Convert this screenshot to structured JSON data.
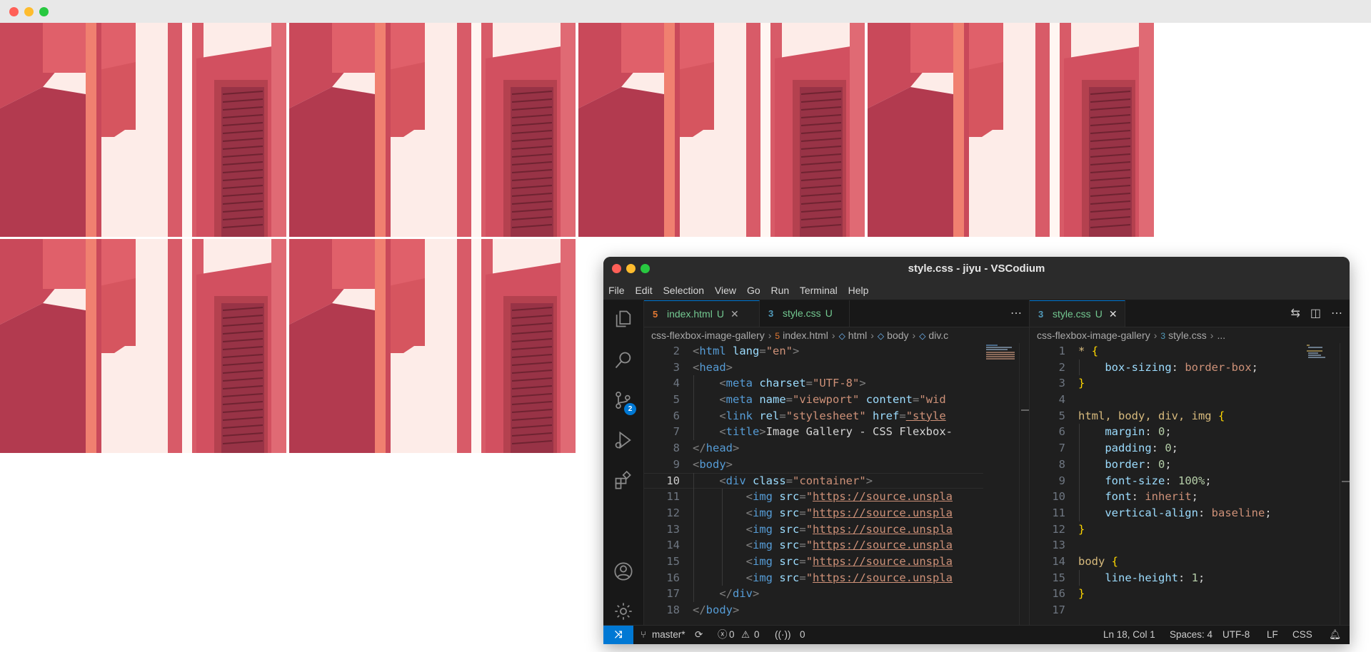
{
  "window": {
    "title": "style.css - jiyu - VSCodium"
  },
  "menu": [
    "File",
    "Edit",
    "Selection",
    "View",
    "Go",
    "Run",
    "Terminal",
    "Help"
  ],
  "gallery": {
    "photo_count": 6
  },
  "activity_bar": {
    "source_control_badge": "2"
  },
  "left_editor": {
    "tabs": [
      {
        "name": "index.html",
        "status": "U",
        "icon": "html-file-icon",
        "color": "#e37933"
      },
      {
        "name": "style.css",
        "status": "U",
        "icon": "css-file-icon",
        "color": "#519aba"
      }
    ],
    "more": "⋯",
    "breadcrumb": [
      "css-flexbox-image-gallery",
      "index.html",
      "html",
      "body",
      "div.c"
    ],
    "lines": [
      {
        "n": "2"
      },
      {
        "n": "3"
      },
      {
        "n": "4"
      },
      {
        "n": "5"
      },
      {
        "n": "6"
      },
      {
        "n": "7"
      },
      {
        "n": "8"
      },
      {
        "n": "9"
      },
      {
        "n": "10"
      },
      {
        "n": "11"
      },
      {
        "n": "12"
      },
      {
        "n": "13"
      },
      {
        "n": "14"
      },
      {
        "n": "15"
      },
      {
        "n": "16"
      },
      {
        "n": "17"
      },
      {
        "n": "18"
      }
    ],
    "code_text": {
      "l2_attr": "lang",
      "l2_val": "\"en\"",
      "l4_attr": "charset",
      "l4_val": "\"UTF-8\"",
      "l5_a1": "name",
      "l5_v1": "\"viewport\"",
      "l5_a2": "content",
      "l5_v2": "\"wid",
      "l6_a1": "rel",
      "l6_v1": "\"stylesheet\"",
      "l6_a2": "href",
      "l6_v2": "\"style",
      "l7_text": "Image Gallery - CSS Flexbox-",
      "l10_attr": "class",
      "l10_val": "\"container\"",
      "img_url": "https://source.unspla"
    }
  },
  "right_editor": {
    "tab": {
      "name": "style.css",
      "status": "U",
      "icon": "css-file-icon",
      "color": "#519aba"
    },
    "breadcrumb": [
      "css-flexbox-image-gallery",
      "style.css",
      "..."
    ],
    "lines": [
      "1",
      "2",
      "3",
      "4",
      "5",
      "6",
      "7",
      "8",
      "9",
      "10",
      "11",
      "12",
      "13",
      "14",
      "15",
      "16",
      "17"
    ],
    "css": {
      "sel1": "*",
      "p_boxsizing": "box-sizing",
      "v_boxsizing": "border-box",
      "sel2": "html, body, div, img",
      "p_margin": "margin",
      "v_margin": "0",
      "p_padding": "padding",
      "v_padding": "0",
      "p_border": "border",
      "v_border": "0",
      "p_fontsize": "font-size",
      "v_fontsize": "100%",
      "p_font": "font",
      "v_font": "inherit",
      "p_valign": "vertical-align",
      "v_valign": "baseline",
      "sel3": "body",
      "p_lineheight": "line-height",
      "v_lineheight": "1"
    }
  },
  "status_bar": {
    "branch": "master*",
    "errors": "0",
    "warnings": "0",
    "ports": "0",
    "position": "Ln 18, Col 1",
    "spaces": "Spaces: 4",
    "encoding": "UTF-8",
    "eol": "LF",
    "language": "CSS"
  },
  "colors": {
    "accent": "#0078d4",
    "html_icon": "#e37933",
    "css_icon": "#519aba",
    "modified_untracked": "#73c991"
  }
}
